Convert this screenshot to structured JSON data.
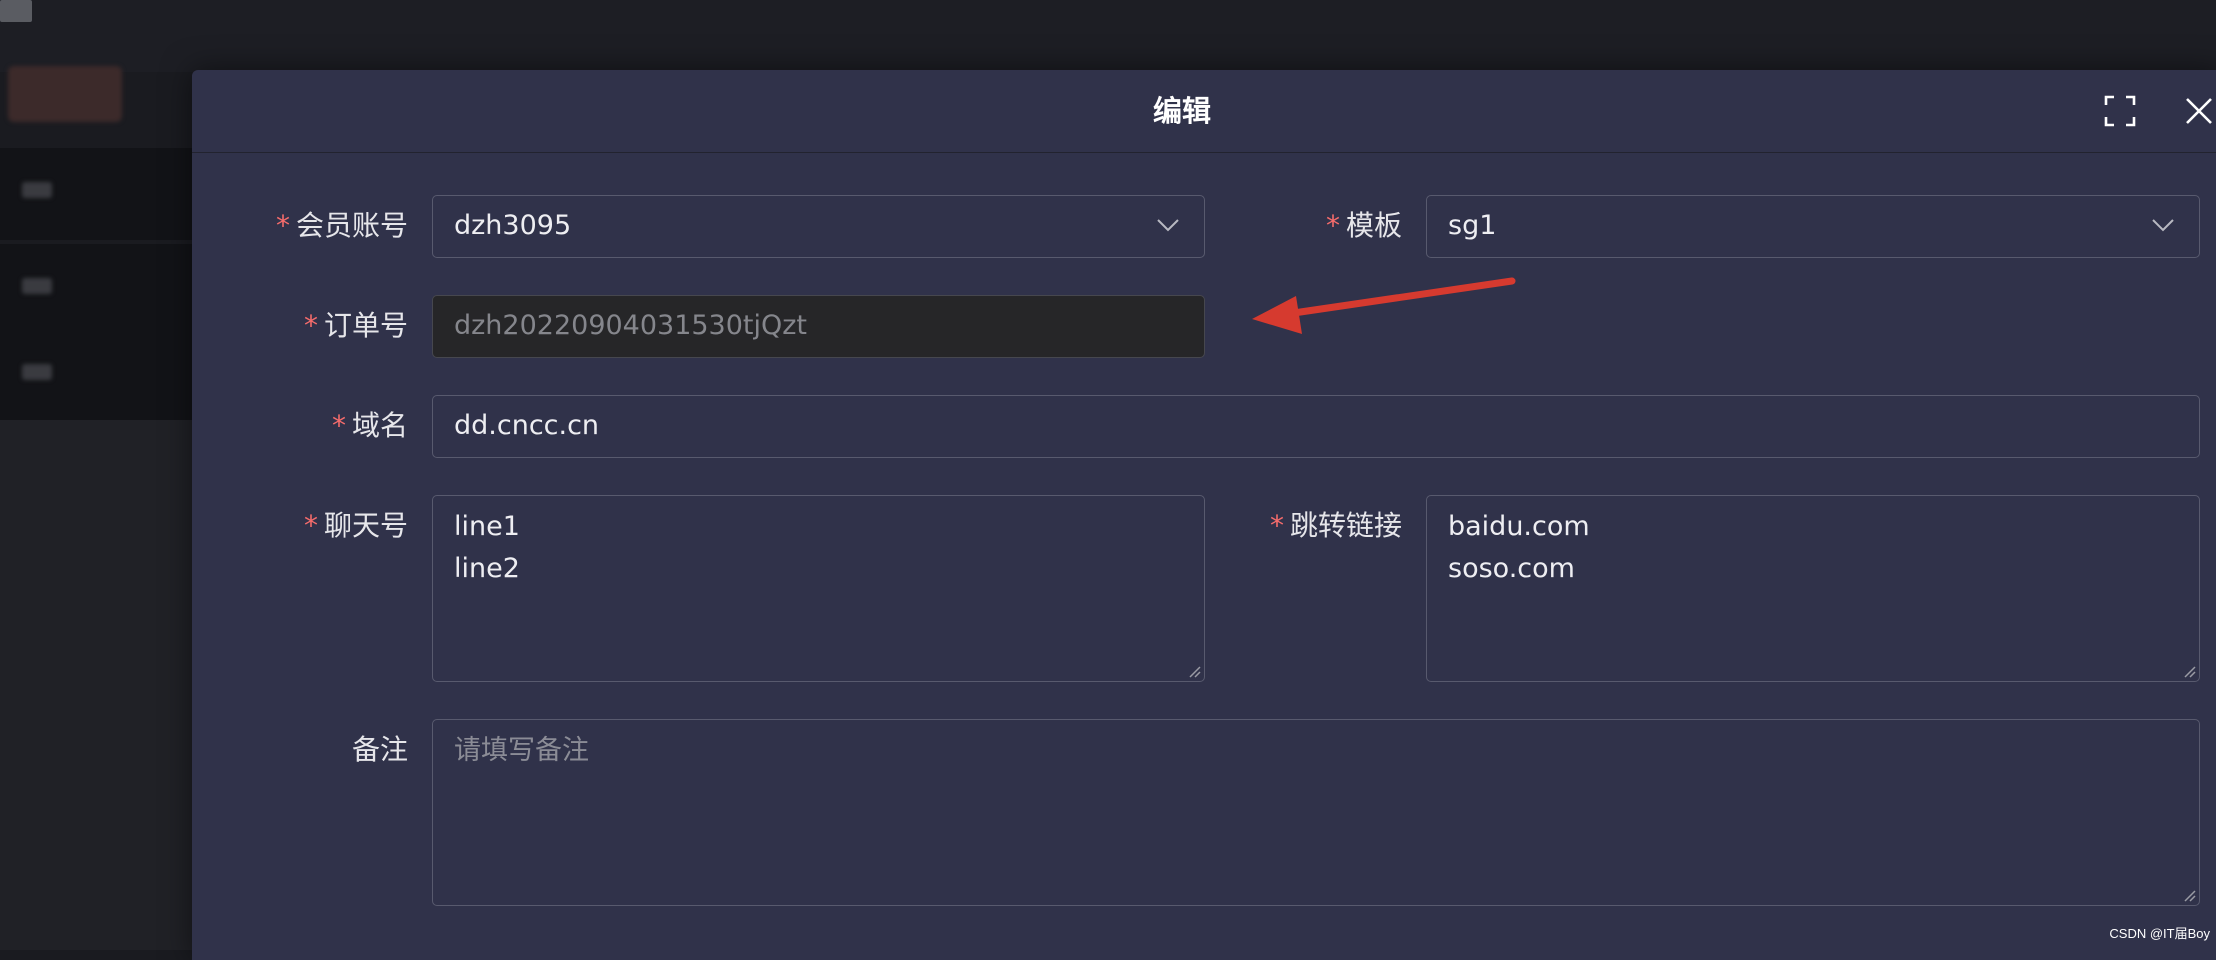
{
  "dialog": {
    "title": "编辑",
    "fullscreen_icon": "fullscreen-icon",
    "close_icon": "close-icon"
  },
  "form": {
    "member_account": {
      "required_mark": "*",
      "label": "会员账号",
      "value": "dzh3095"
    },
    "template": {
      "required_mark": "*",
      "label": "模板",
      "value": "sg1"
    },
    "order_no": {
      "required_mark": "*",
      "label": "订单号",
      "value": "dzh20220904031530tjQzt",
      "disabled": true
    },
    "domain": {
      "required_mark": "*",
      "label": "域名",
      "value": "dd.cncc.cn"
    },
    "chat_no": {
      "required_mark": "*",
      "label": "聊天号",
      "value": "line1\nline2"
    },
    "redirect_link": {
      "required_mark": "*",
      "label": "跳转链接",
      "value": "baidu.com\nsoso.com"
    },
    "remark": {
      "label": "备注",
      "placeholder": "请填写备注",
      "value": ""
    }
  },
  "annotation": {
    "arrow_color": "#d63a2f"
  },
  "colors": {
    "dialog_bg": "#30324a",
    "required": "#f56c6c",
    "page_bg": "#1a1b20"
  },
  "watermark": "CSDN @IT届Boy"
}
